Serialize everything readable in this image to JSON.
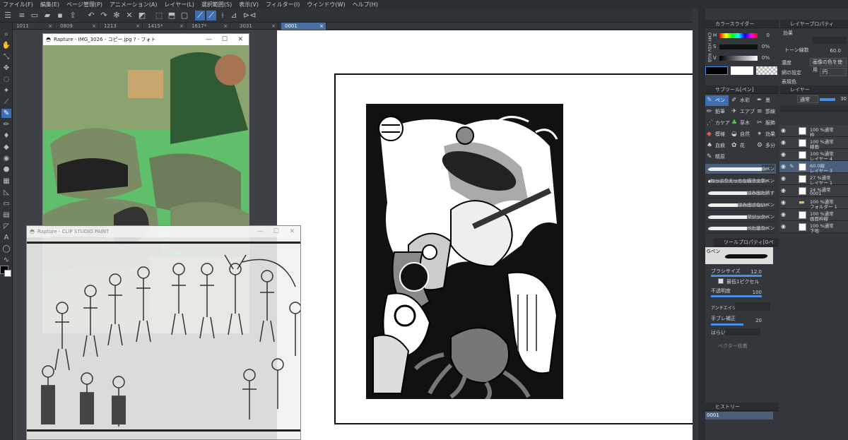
{
  "menu": [
    "ファイル(F)",
    "編集(E)",
    "ページ管理(P)",
    "アニメーション(A)",
    "レイヤー(L)",
    "選択範囲(S)",
    "表示(V)",
    "フィルター(I)",
    "ウィンドウ(W)",
    "ヘルプ(H)"
  ],
  "tabs": [
    {
      "label": "1011",
      "active": false
    },
    {
      "label": "0809",
      "active": false
    },
    {
      "label": "1213",
      "active": false
    },
    {
      "label": "1415*",
      "active": false
    },
    {
      "label": "1617*",
      "active": false
    },
    {
      "label": "3031",
      "active": false
    },
    {
      "label": "0001",
      "active": true
    }
  ],
  "photo_window": {
    "title": "Rapture - IMG_3026 - コピー.jpg ? - フォト"
  },
  "csp_window": {
    "title": "Rapture - CLIP STUDIO PAINT"
  },
  "color_slider": {
    "title": "カラースライダー",
    "h_label": "H",
    "h_value": "0",
    "s_label": "S",
    "s_value": "0%",
    "v_label": "V",
    "v_value": "0%",
    "mode_tabs": "CMY HSV RGB"
  },
  "layer_property": {
    "title": "レイヤープロパティ",
    "effect_label": "効果",
    "tone_label": "トーン線数",
    "tone_value": "60.0",
    "density_label": "濃度",
    "density_value": "画像の色を使用",
    "mesh_label": "網の設定",
    "mesh_value": "円",
    "express_label": "表現色"
  },
  "layer_panel": {
    "title": "レイヤー",
    "blend": "通常",
    "opacity": "30",
    "layers": [
      {
        "line1": "100 %通常",
        "line2": "枠",
        "selected": false
      },
      {
        "line1": "100 %通常",
        "line2": "線画",
        "selected": false
      },
      {
        "line1": "100 %通常",
        "line2": "レイヤー 4",
        "selected": false
      },
      {
        "line1": "60.0線",
        "line2": "レイヤー 3",
        "selected": true
      },
      {
        "line1": "27 %通常",
        "line2": "レイヤー 1",
        "selected": false
      },
      {
        "line1": "24 %通常",
        "line2": "0001",
        "selected": false
      },
      {
        "line1": "100 %通常",
        "line2": "フォルダー 1",
        "selected": false
      },
      {
        "line1": "100 %通常",
        "line2": "画面枠線",
        "selected": false
      },
      {
        "line1": "100 %通常",
        "line2": "下地",
        "selected": false
      }
    ]
  },
  "subtool": {
    "title": "サブツール[ペン]",
    "items": [
      {
        "label": "ペン",
        "icon": "pen-icon",
        "on": true
      },
      {
        "label": "水彩",
        "icon": "watercolor-icon",
        "on": false
      },
      {
        "label": "墨",
        "icon": "ink-icon",
        "on": false
      },
      {
        "label": "鉛筆",
        "icon": "pencil-icon",
        "on": false
      },
      {
        "label": "エアブ",
        "icon": "airbrush-icon",
        "on": false
      },
      {
        "label": "罫線",
        "icon": "ruled-icon",
        "on": false
      },
      {
        "label": "カケア",
        "icon": "hatch-icon",
        "on": false
      },
      {
        "label": "草木",
        "icon": "plant-icon",
        "on": false
      },
      {
        "label": "服飾",
        "icon": "clothing-icon",
        "on": false
      },
      {
        "label": "模様",
        "icon": "pattern-icon",
        "on": false
      },
      {
        "label": "自然",
        "icon": "nature-icon",
        "on": false
      },
      {
        "label": "効果",
        "icon": "effect-icon",
        "on": false
      },
      {
        "label": "血痕",
        "icon": "blood-icon",
        "on": false
      },
      {
        "label": "花",
        "icon": "flower-icon",
        "on": false
      },
      {
        "label": "多分",
        "icon": "misc-icon",
        "on": false
      },
      {
        "label": "精原",
        "icon": "source-icon",
        "on": false
      }
    ],
    "brushes": [
      "Gペン",
      "ねっぷりえっちな描き文字ペン",
      "はみ出た消す",
      "はみ出さないペン",
      "マジックペン",
      "べた塗りペン"
    ]
  },
  "tool_property": {
    "title": "ツールプロパティ[Gペン]",
    "brush_name": "Gペン",
    "size_label": "ブラシサイズ",
    "size_value": "12.0",
    "min_label": "最低1ピクセル",
    "opacity_label": "不透明度",
    "opacity_value": "100",
    "aa_label": "アンチエイリアス",
    "stab_label": "手ブレ補正",
    "stab_value": "20",
    "harai_label": "はらい",
    "vector_label": "ベクター吸着"
  },
  "history": {
    "title": "ヒストリー",
    "item": "0001"
  },
  "colors": {
    "accent": "#3f6fb0",
    "panel": "#33363b",
    "canvas": "#3d4045",
    "page": "#ffffff"
  }
}
